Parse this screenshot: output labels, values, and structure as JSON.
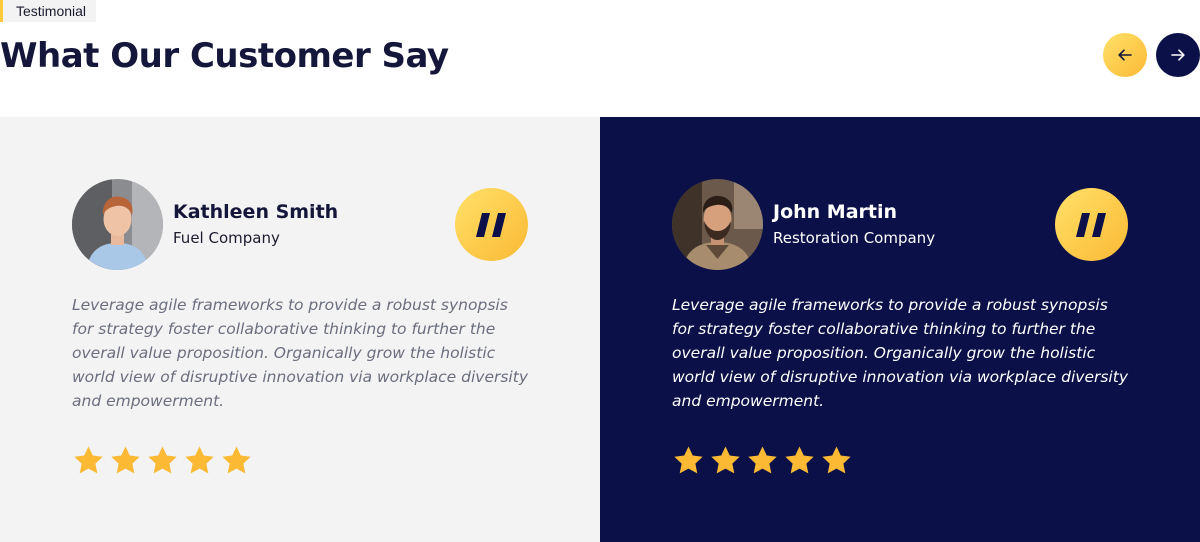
{
  "header": {
    "tag_label": "Testimonial",
    "title": "What Our Customer Say"
  },
  "navigation": {
    "prev_icon": "arrow-left-icon",
    "next_icon": "arrow-right-icon"
  },
  "testimonials": [
    {
      "name": "Kathleen Smith",
      "company": "Fuel Company",
      "quote": "Leverage agile frameworks to provide a robust synopsis for strategy foster collaborative thinking to further the overall value proposition. Organically grow the holistic world view of disruptive innovation via workplace diversity and empowerment.",
      "rating": 5,
      "max_rating": 5
    },
    {
      "name": "John Martin",
      "company": "Restoration Company",
      "quote": "Leverage agile frameworks to provide a robust synopsis for strategy foster collaborative thinking to further the overall value proposition. Organically grow the holistic world view of disruptive innovation via workplace diversity and empowerment.",
      "rating": 5,
      "max_rating": 5
    }
  ],
  "colors": {
    "accent_yellow": "#fbb934",
    "navy": "#0b1148",
    "light_gray": "#f3f3f3",
    "star": "#fbb934"
  }
}
